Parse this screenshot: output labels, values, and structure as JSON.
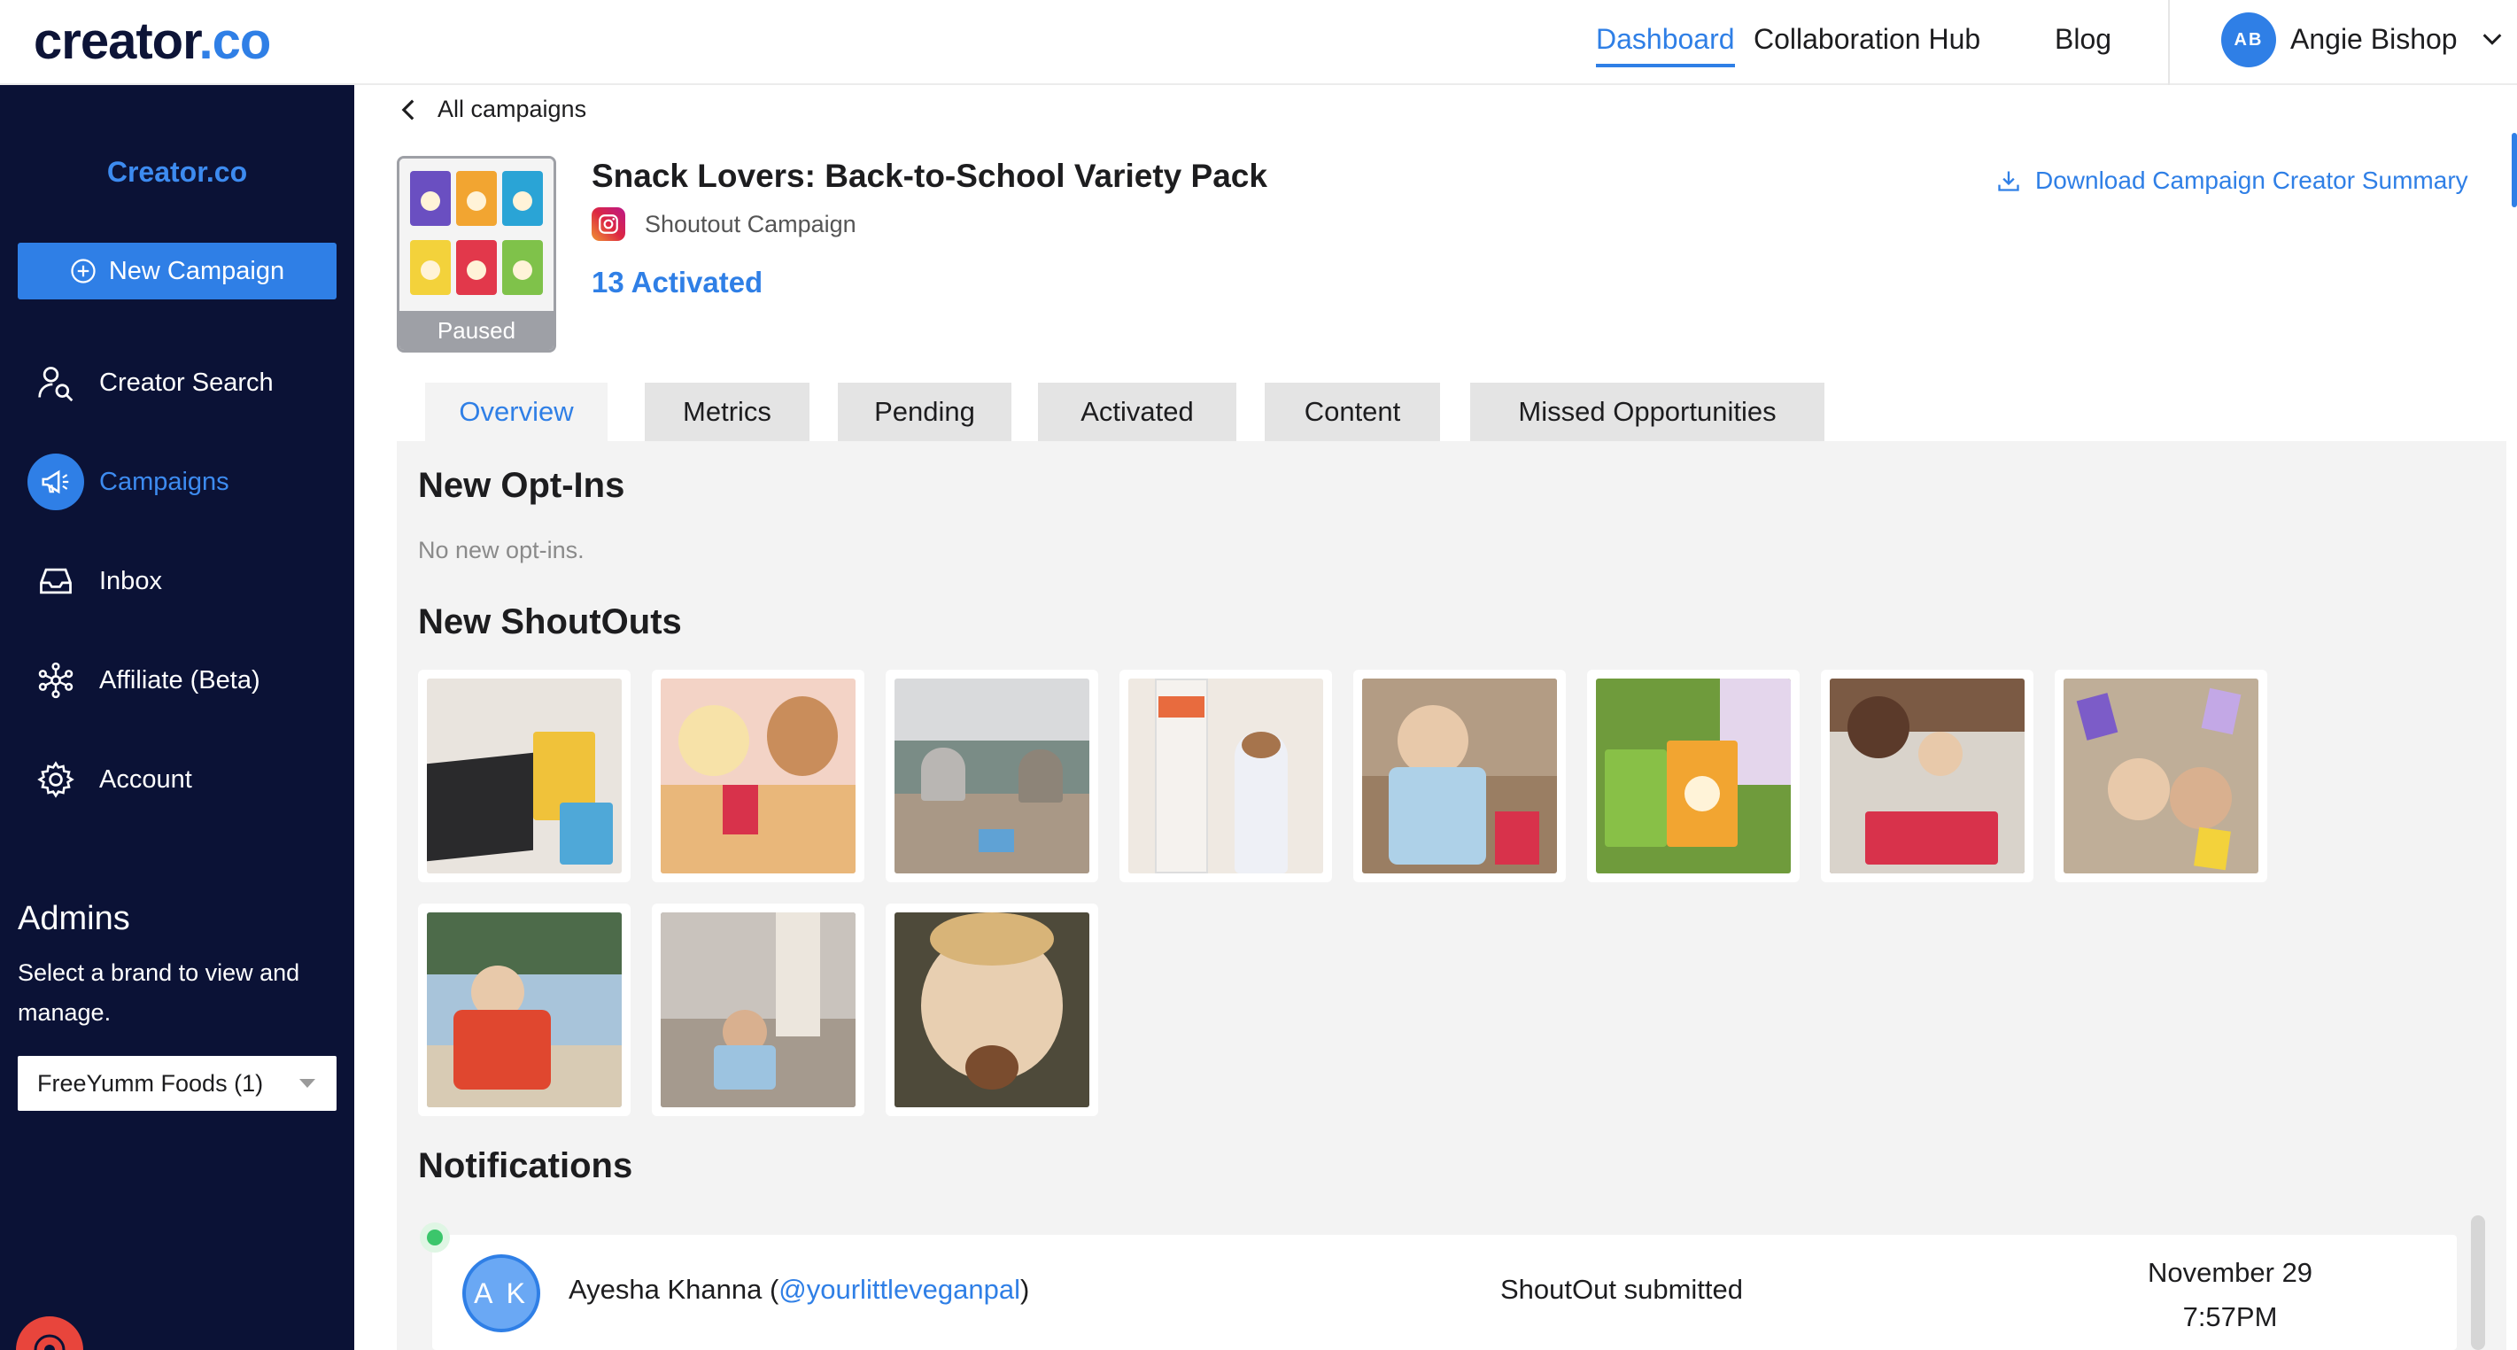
{
  "app": {
    "logo_text": "creator",
    "logo_suffix": ".co"
  },
  "topnav": {
    "items": [
      {
        "label": "Dashboard",
        "active": true
      },
      {
        "label": "Collaboration Hub",
        "active": false
      },
      {
        "label": "Blog",
        "active": false
      }
    ],
    "user": {
      "initials": "AB",
      "name": "Angie Bishop"
    }
  },
  "sidebar": {
    "brand": "Creator.co",
    "new_campaign_label": "New Campaign",
    "items": [
      {
        "label": "Creator Search",
        "icon": "creator-search-icon",
        "active": false
      },
      {
        "label": "Campaigns",
        "icon": "megaphone-icon",
        "active": true
      },
      {
        "label": "Inbox",
        "icon": "inbox-icon",
        "active": false
      },
      {
        "label": "Affiliate (Beta)",
        "icon": "network-icon",
        "active": false
      },
      {
        "label": "Account",
        "icon": "gear-icon",
        "active": false
      }
    ],
    "admins": {
      "title": "Admins",
      "description": "Select a brand to view and manage.",
      "selected_brand": "FreeYumm Foods (1)"
    }
  },
  "campaign": {
    "back_label": "All campaigns",
    "title": "Snack Lovers: Back-to-School Variety Pack",
    "type": "Shoutout Campaign",
    "activated": "13 Activated",
    "status": "Paused",
    "download_label": "Download Campaign Creator Summary"
  },
  "tabs": [
    {
      "label": "Overview",
      "active": true
    },
    {
      "label": "Metrics",
      "active": false
    },
    {
      "label": "Pending",
      "active": false
    },
    {
      "label": "Activated",
      "active": false
    },
    {
      "label": "Content",
      "active": false
    },
    {
      "label": "Missed Opportunities",
      "active": false
    }
  ],
  "overview": {
    "optins_title": "New Opt-Ins",
    "optins_empty": "No new opt-ins.",
    "shoutouts_title": "New ShoutOuts",
    "shoutout_count": 11,
    "notifications_title": "Notifications",
    "notifications": [
      {
        "initials": "A K",
        "name": "Ayesha Khanna (",
        "handle": "@yourlittleveganpal",
        "name_close": ")",
        "event": "ShoutOut submitted",
        "date": "November 29",
        "time": "7:57PM"
      }
    ]
  },
  "colors": {
    "accent": "#2f7fe6",
    "sidebar_bg": "#0b1236",
    "paused": "#9ea0a6",
    "online": "#3bc66b"
  }
}
